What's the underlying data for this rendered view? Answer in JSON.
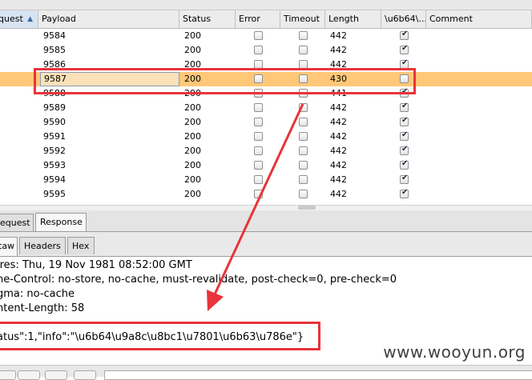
{
  "table": {
    "columns": [
      {
        "key": "request",
        "label": "quest"
      },
      {
        "key": "payload",
        "label": "Payload"
      },
      {
        "key": "status",
        "label": "Status"
      },
      {
        "key": "error",
        "label": "Error"
      },
      {
        "key": "timeout",
        "label": "Timeout"
      },
      {
        "key": "length",
        "label": "Length"
      },
      {
        "key": "grep",
        "label": "\\u6b64\\..."
      },
      {
        "key": "comment",
        "label": "Comment"
      }
    ],
    "rows": [
      {
        "payload": "9584",
        "status": "200",
        "error": false,
        "timeout": false,
        "length": "442",
        "grep": true
      },
      {
        "payload": "9585",
        "status": "200",
        "error": false,
        "timeout": false,
        "length": "442",
        "grep": true
      },
      {
        "payload": "9586",
        "status": "200",
        "error": false,
        "timeout": false,
        "length": "442",
        "grep": true
      },
      {
        "payload": "9587",
        "status": "200",
        "error": false,
        "timeout": false,
        "length": "430",
        "grep": false,
        "selected": true
      },
      {
        "payload": "9588",
        "status": "200",
        "error": false,
        "timeout": false,
        "length": "441",
        "grep": true
      },
      {
        "payload": "9589",
        "status": "200",
        "error": false,
        "timeout": false,
        "length": "442",
        "grep": true
      },
      {
        "payload": "9590",
        "status": "200",
        "error": false,
        "timeout": false,
        "length": "442",
        "grep": true
      },
      {
        "payload": "9591",
        "status": "200",
        "error": false,
        "timeout": false,
        "length": "442",
        "grep": true
      },
      {
        "payload": "9592",
        "status": "200",
        "error": false,
        "timeout": false,
        "length": "442",
        "grep": true
      },
      {
        "payload": "9593",
        "status": "200",
        "error": false,
        "timeout": false,
        "length": "442",
        "grep": true
      },
      {
        "payload": "9594",
        "status": "200",
        "error": false,
        "timeout": false,
        "length": "442",
        "grep": true
      },
      {
        "payload": "9595",
        "status": "200",
        "error": false,
        "timeout": false,
        "length": "442",
        "grep": true
      }
    ]
  },
  "tabs_top": [
    {
      "label": "equest",
      "active": false
    },
    {
      "label": "Response",
      "active": true
    }
  ],
  "tabs_view": [
    {
      "label": "taw",
      "active": true
    },
    {
      "label": "Headers",
      "active": false
    },
    {
      "label": "Hex",
      "active": false
    }
  ],
  "response": {
    "lines": [
      "ires: Thu, 19 Nov 1981 08:52:00 GMT",
      "he-Control: no-store, no-cache, must-revalidate, post-check=0, pre-check=0",
      "gma: no-cache",
      "ntent-Length: 58",
      "",
      "atus\":1,\"info\":\"\\u6b64\\u9a8c\\u8bc1\\u7801\\u6b63\\u786e\"}"
    ]
  },
  "watermark": "www.wooyun.org",
  "colors": {
    "selected_row": "#ffc878",
    "annotation_red": "#e8343a"
  }
}
